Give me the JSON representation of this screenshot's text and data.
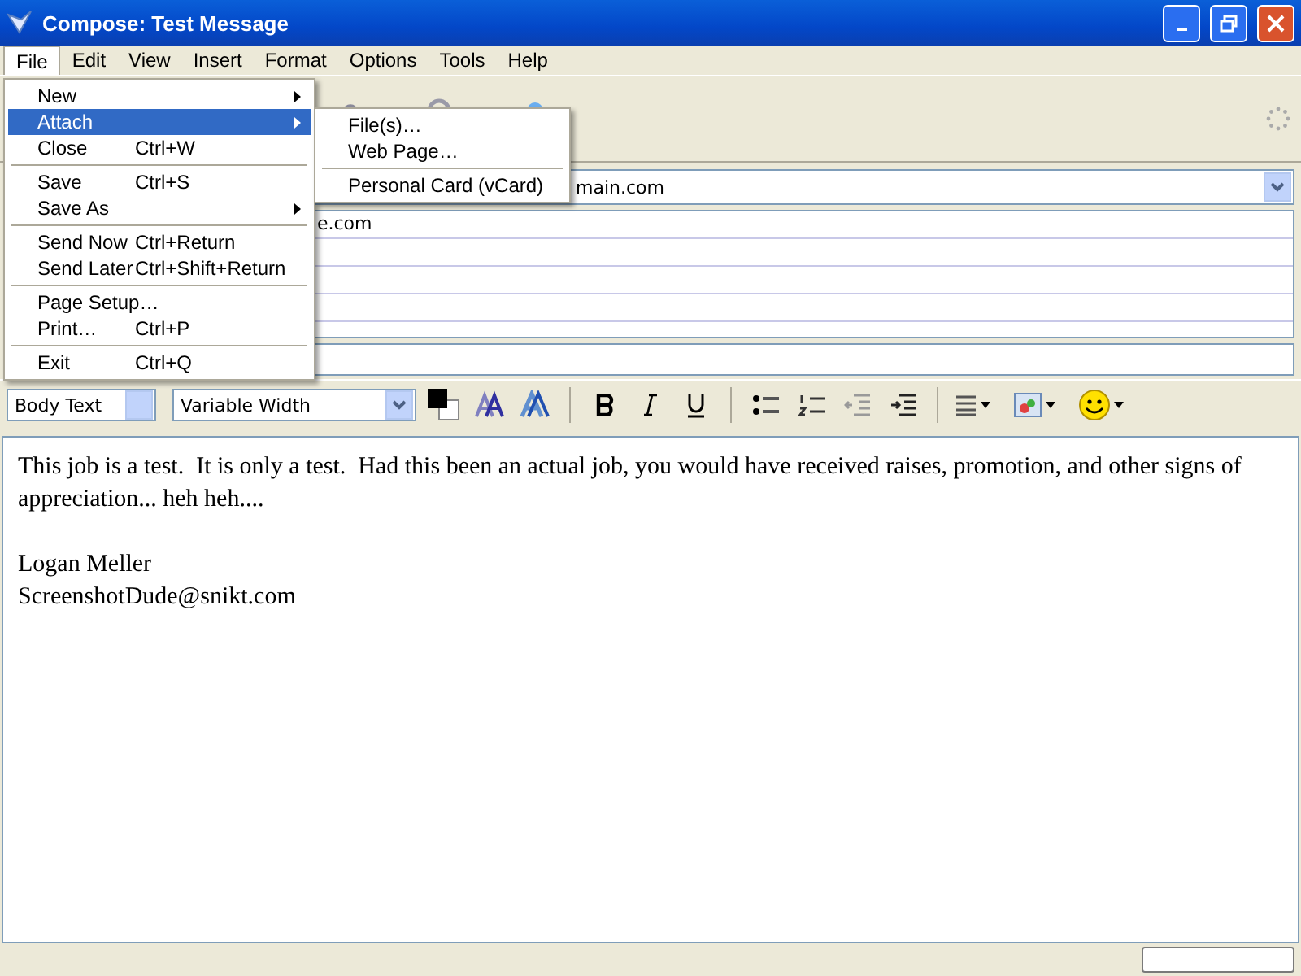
{
  "window": {
    "title": "Compose: Test Message"
  },
  "menu_bar": [
    {
      "label": "File",
      "selected": true
    },
    {
      "label": "Edit",
      "selected": false
    },
    {
      "label": "View",
      "selected": false
    },
    {
      "label": "Insert",
      "selected": false
    },
    {
      "label": "Format",
      "selected": false
    },
    {
      "label": "Options",
      "selected": false
    },
    {
      "label": "Tools",
      "selected": false
    },
    {
      "label": "Help",
      "selected": false
    }
  ],
  "file_menu": [
    {
      "kind": "item",
      "label": "New",
      "submenu": true,
      "selected": false
    },
    {
      "kind": "item",
      "label": "Attach",
      "submenu": true,
      "selected": true
    },
    {
      "kind": "item",
      "label": "Close",
      "shortcut": "Ctrl+W",
      "selected": false
    },
    {
      "kind": "separator"
    },
    {
      "kind": "item",
      "label": "Save",
      "shortcut": "Ctrl+S",
      "selected": false
    },
    {
      "kind": "item",
      "label": "Save As",
      "submenu": true,
      "selected": false
    },
    {
      "kind": "separator"
    },
    {
      "kind": "item",
      "label": "Send Now",
      "shortcut": "Ctrl+Return",
      "selected": false
    },
    {
      "kind": "item",
      "label": "Send Later",
      "shortcut": "Ctrl+Shift+Return",
      "selected": false
    },
    {
      "kind": "separator"
    },
    {
      "kind": "item",
      "label": "Page Setup…",
      "selected": false
    },
    {
      "kind": "item",
      "label": "Print…",
      "shortcut": "Ctrl+P",
      "selected": false
    },
    {
      "kind": "separator"
    },
    {
      "kind": "item",
      "label": "Exit",
      "shortcut": "Ctrl+Q",
      "selected": false
    }
  ],
  "attach_submenu": [
    {
      "kind": "item",
      "label": "File(s)…"
    },
    {
      "kind": "item",
      "label": "Web Page…"
    },
    {
      "kind": "separator"
    },
    {
      "kind": "item",
      "label": "Personal Card (vCard)"
    }
  ],
  "from_field": {
    "value": "main.com"
  },
  "recipients": [
    {
      "value": "e.com"
    }
  ],
  "format_toolbar": {
    "paragraph_style": "Body Text",
    "font": "Variable Width"
  },
  "body": {
    "paragraphs": [
      "This job is a test.  It is only a test.  Had this been an actual job, you would have received raises, promotion, and other signs of appreciation... heh heh....",
      "Logan Meller\nScreenshotDude@snikt.com"
    ]
  }
}
